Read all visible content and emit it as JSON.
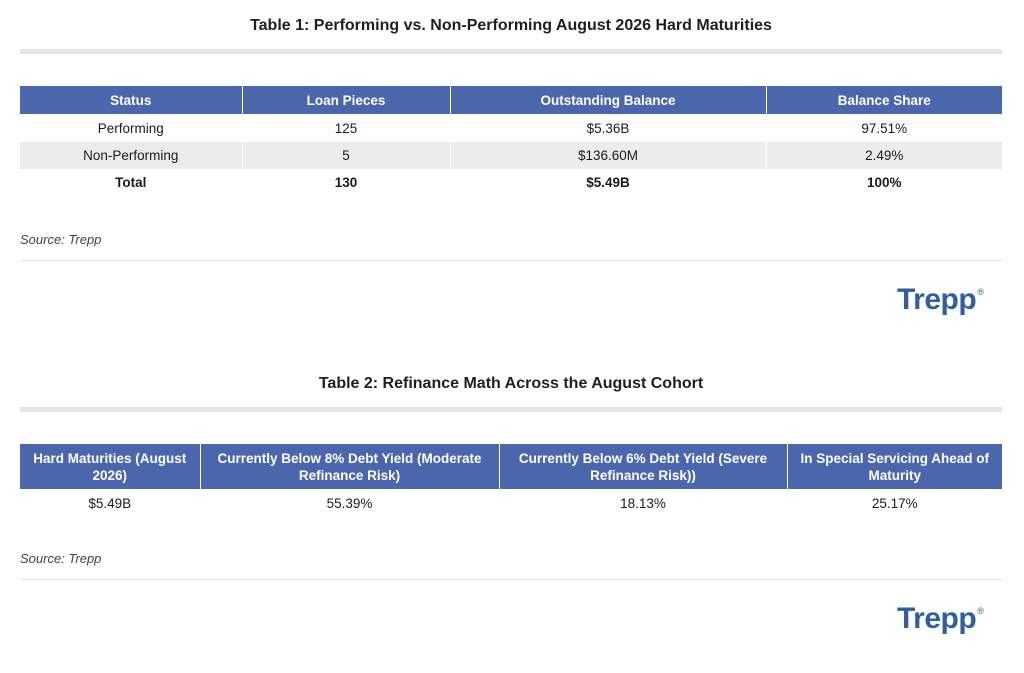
{
  "table1": {
    "title": "Table 1: Performing vs. Non-Performing August 2026 Hard Maturities",
    "headers": [
      "Status",
      "Loan Pieces",
      "Outstanding Balance",
      "Balance Share"
    ],
    "rows": [
      [
        "Performing",
        "125",
        "$5.36B",
        "97.51%"
      ],
      [
        "Non-Performing",
        "5",
        "$136.60M",
        "2.49%"
      ],
      [
        "Total",
        "130",
        "$5.49B",
        "100%"
      ]
    ],
    "source": "Source: Trepp"
  },
  "table2": {
    "title": "Table 2: Refinance Math Across the August Cohort",
    "headers": [
      "Hard Maturities (August 2026)",
      "Currently Below 8% Debt Yield (Moderate Refinance Risk)",
      "Currently Below 6% Debt Yield (Severe Refinance Risk))",
      "In Special Servicing Ahead of Maturity"
    ],
    "rows": [
      [
        "$5.49B",
        "55.39%",
        "18.13%",
        "25.17%"
      ]
    ],
    "source": "Source: Trepp"
  },
  "logo": {
    "text": "Trepp",
    "mark": "®",
    "color": "#2f5f9e"
  },
  "colors": {
    "header_bg": "#4a67ad",
    "stripe_bg": "#ececec",
    "rule": "#e6e6e6"
  }
}
